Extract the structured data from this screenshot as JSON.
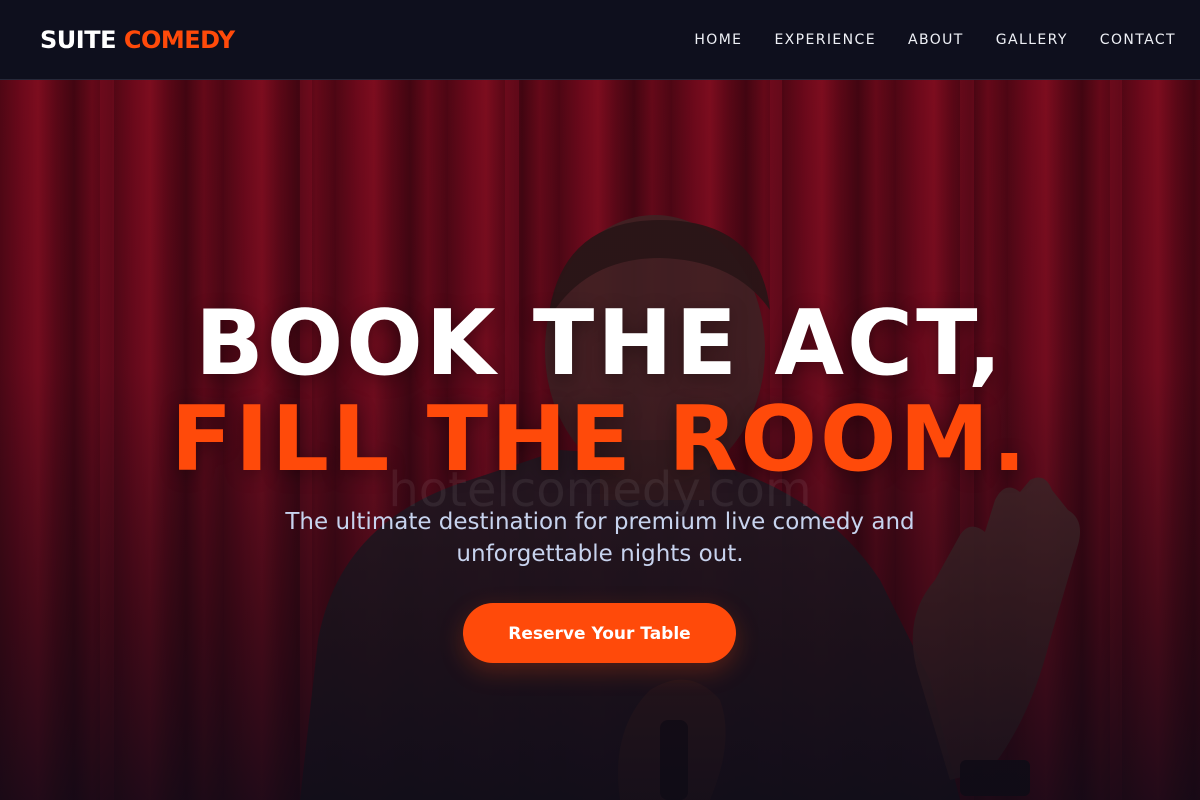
{
  "brand": {
    "logo_part_1": "SUITE",
    "logo_part_2": "COMEDY",
    "accent_color": "#ff4a0a"
  },
  "nav": {
    "items": [
      {
        "label": "HOME"
      },
      {
        "label": "EXPERIENCE"
      },
      {
        "label": "ABOUT"
      },
      {
        "label": "GALLERY"
      },
      {
        "label": "CONTACT"
      }
    ]
  },
  "hero": {
    "headline_line_1": "BOOK THE ACT,",
    "headline_line_2": "FILL THE ROOM.",
    "watermark": "hotelcomedy.com",
    "subtitle": "The ultimate destination for premium live comedy and unforgettable nights out.",
    "cta_label": "Reserve Your Table",
    "background_color": "#8a0c20"
  }
}
